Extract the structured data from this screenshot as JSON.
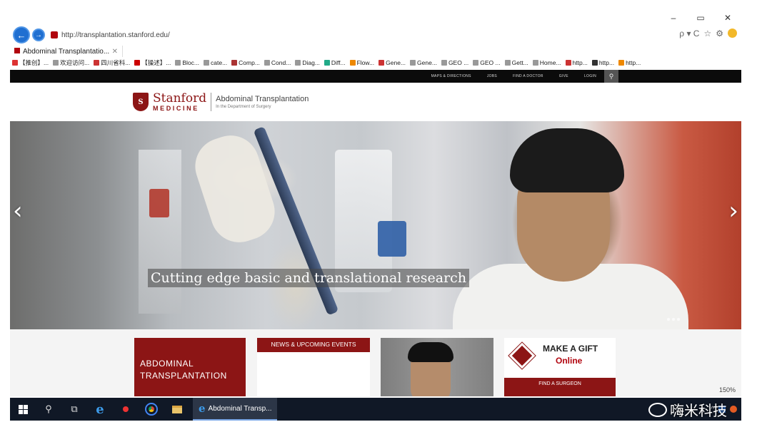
{
  "window_controls": {
    "minimize": "–",
    "restore": "▭",
    "close": "✕"
  },
  "browser": {
    "back_glyph": "←",
    "forward_glyph": "→",
    "url": "http://transplantation.stanford.edu/",
    "address_icons": [
      "ρ ▾ C",
      "☆",
      "⚙"
    ],
    "tab": {
      "title": "Abdominal Transplantatio...",
      "close": "✕"
    },
    "favorites": [
      "【推创】...",
      "欢迎访问...",
      "四川省科...",
      "【操述】...",
      "Bloc...",
      "cate...",
      "Comp...",
      "Cond...",
      "Diag...",
      "Diff...",
      "Flow...",
      "Gene...",
      "Gene...",
      "GEO ...",
      "GEO ...",
      "Gett...",
      "Home...",
      "http...",
      "http...",
      "http..."
    ]
  },
  "site": {
    "top_nav": [
      "Maps & Directions",
      "Jobs",
      "Find a Doctor",
      "Give",
      "Login"
    ],
    "search_glyph": "⚲",
    "logo": {
      "shield_letter": "S",
      "line1": "Stanford",
      "line2": "MEDICINE"
    },
    "department": {
      "name": "Abdominal Transplantation",
      "sub": "In the Department of Surgery"
    },
    "hero": {
      "caption": "Cutting edge basic and translational research",
      "prev": "‹",
      "next": "›"
    },
    "cards": {
      "red_title": "ABDOMINAL TRANSPLANTATION",
      "news_title": "NEWS & UPCOMING EVENTS",
      "gift_title": "MAKE A GIFT",
      "gift_sub": "Online",
      "gift_button": "FIND A SURGEON"
    },
    "zoom": "150%"
  },
  "taskbar": {
    "active_window": "Abdominal Transp...",
    "tray_arrow": "^",
    "search_glyph": "⚲",
    "taskview_glyph": "⧉"
  },
  "watermark": "嗨米科技",
  "colors": {
    "stanford_red": "#8c1515",
    "taskbar": "#101826",
    "ie_blue": "#1f6fd1"
  }
}
